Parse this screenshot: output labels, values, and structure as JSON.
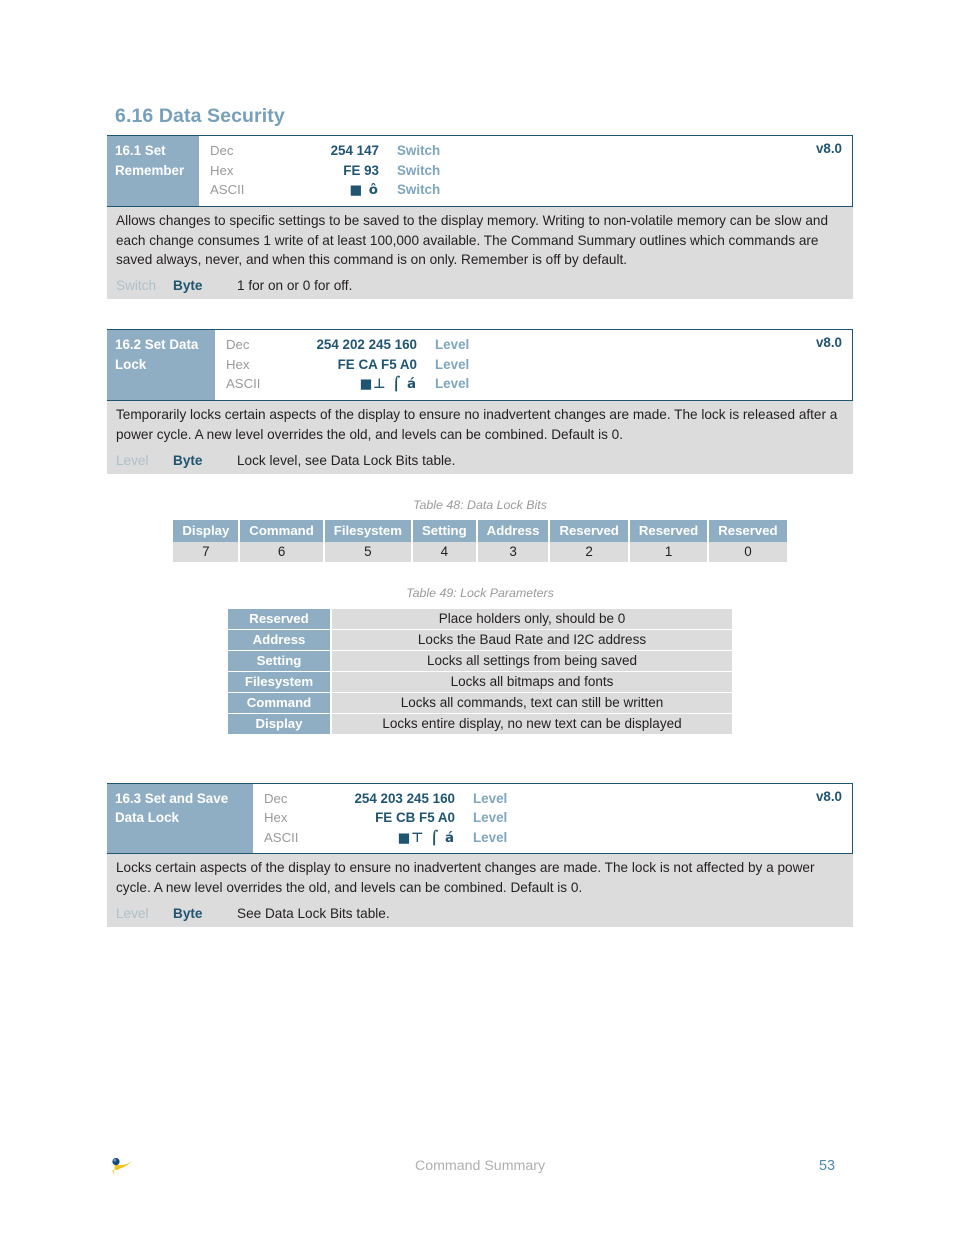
{
  "section": {
    "heading": "6.16 Data Security"
  },
  "commands": [
    {
      "name": "16.1 Set Remember",
      "version": "v8.0",
      "rows": [
        {
          "label": "Dec",
          "value": "254 147",
          "param": "Switch"
        },
        {
          "label": "Hex",
          "value": "FE 93",
          "param": "Switch"
        },
        {
          "label": "ASCII",
          "value": "■ ô",
          "param": "Switch"
        }
      ],
      "description": "Allows changes to specific settings to be saved to the display memory.  Writing to non-volatile memory can be slow and each change consumes 1 write of at least 100,000 available.  The Command Summary outlines which commands are saved always, never, and when this command is on only.  Remember is off by default.",
      "parameter": {
        "name": "Switch",
        "type": "Byte",
        "desc": "1 for on or 0 for off."
      }
    },
    {
      "name": "16.2 Set Data Lock",
      "version": "v8.0",
      "rows": [
        {
          "label": "Dec",
          "value": "254 202 245 160",
          "param": "Level"
        },
        {
          "label": "Hex",
          "value": "FE CA F5 A0",
          "param": "Level"
        },
        {
          "label": "ASCII",
          "value": "■⊥ ⌠ á",
          "param": "Level"
        }
      ],
      "description": "Temporarily locks certain aspects of the display to ensure no inadvertent changes are made.  The lock is released after a power cycle.  A new level overrides the old, and levels can be combined.  Default is 0.",
      "parameter": {
        "name": "Level",
        "type": "Byte",
        "desc": "Lock level, see Data Lock Bits table."
      }
    },
    {
      "name": "16.3 Set and Save Data Lock",
      "version": "v8.0",
      "rows": [
        {
          "label": "Dec",
          "value": "254 203 245 160",
          "param": "Level"
        },
        {
          "label": "Hex",
          "value": "FE CB F5 A0",
          "param": "Level"
        },
        {
          "label": "ASCII",
          "value": "■⊤ ⌠ á",
          "param": "Level"
        }
      ],
      "description": "Locks certain aspects of the display to ensure no inadvertent changes are made.  The lock is not affected by a power cycle.  A new level overrides the old, and levels can be combined.  Default is 0.",
      "parameter": {
        "name": "Level",
        "type": "Byte",
        "desc": "See Data Lock Bits table."
      }
    }
  ],
  "table48": {
    "caption": "Table 48: Data Lock Bits",
    "headers": [
      "Display",
      "Command",
      "Filesystem",
      "Setting",
      "Address",
      "Reserved",
      "Reserved",
      "Reserved"
    ],
    "values": [
      "7",
      "6",
      "5",
      "4",
      "3",
      "2",
      "1",
      "0"
    ]
  },
  "table49": {
    "caption": "Table 49: Lock Parameters",
    "rows": [
      {
        "label": "Reserved",
        "desc": "Place holders only, should be 0"
      },
      {
        "label": "Address",
        "desc": "Locks the Baud Rate and I2C address"
      },
      {
        "label": "Setting",
        "desc": "Locks all settings from being saved"
      },
      {
        "label": "Filesystem",
        "desc": "Locks all bitmaps and fonts"
      },
      {
        "label": "Command",
        "desc": "Locks all commands, text can still be written"
      },
      {
        "label": "Display",
        "desc": "Locks entire display, no new text can be displayed"
      }
    ]
  },
  "footer": {
    "center": "Command Summary",
    "page": "53"
  },
  "colors": {
    "accent_blue": "#76A0BC",
    "header_fill": "#8FAEC3",
    "dark_blue": "#1F5571",
    "row_fill": "#DCDCDC",
    "muted": "#9a9a9a"
  }
}
